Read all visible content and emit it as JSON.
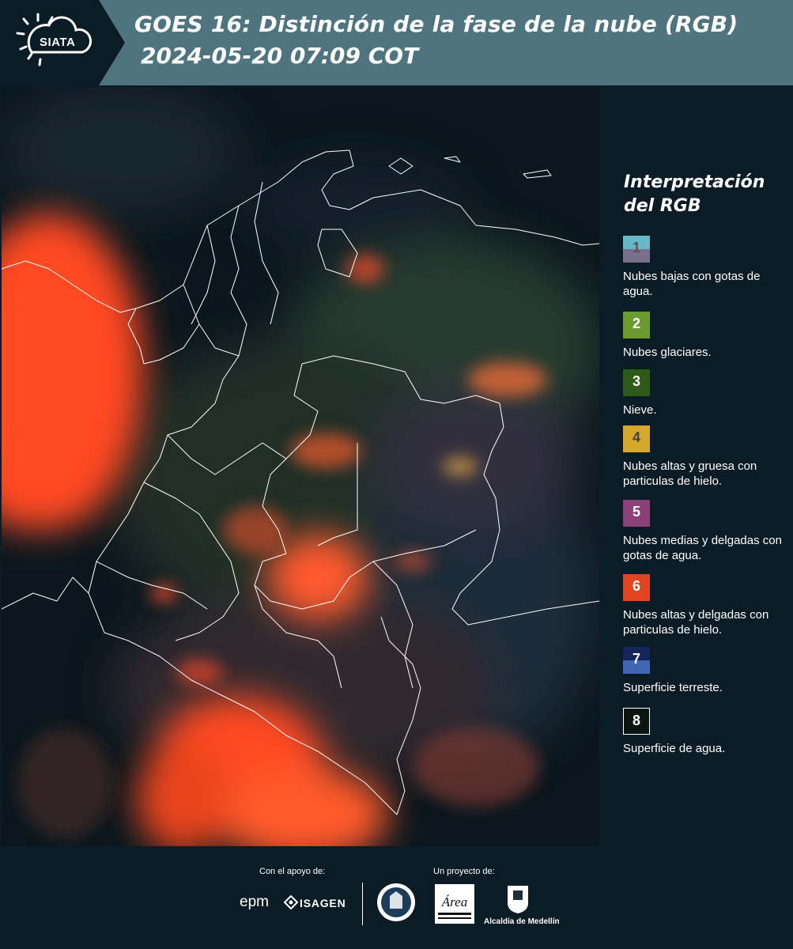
{
  "header": {
    "logo_text": "SIATA",
    "title_line1": "GOES 16: Distinción de la fase de la nube (RGB)",
    "title_line2": "2024-05-20 07:09 COT"
  },
  "legend": {
    "title_line1": "Interpretación",
    "title_line2": "del RGB",
    "items": [
      {
        "number": "1",
        "top_color": "#67b8c6",
        "bottom_color": "#7a6f8c",
        "label_color": "#555555",
        "description": "Nubes bajas con gotas de agua."
      },
      {
        "number": "2",
        "top_color": "#6b9a2e",
        "bottom_color": "#6b9a2e",
        "label_color": "#ffffff",
        "description": "Nubes glaciares."
      },
      {
        "number": "3",
        "top_color": "#2e5a19",
        "bottom_color": "#2e5a19",
        "label_color": "#ffffff",
        "description": "Nieve."
      },
      {
        "number": "4",
        "top_color": "#d5a72b",
        "bottom_color": "#d5a72b",
        "label_color": "#444444",
        "description": "Nubes altas y gruesa con particulas de hielo."
      },
      {
        "number": "5",
        "top_color": "#8c4078",
        "bottom_color": "#8c4078",
        "label_color": "#ffffff",
        "description": "Nubes medias y delgadas con gotas de agua."
      },
      {
        "number": "6",
        "top_color": "#e04520",
        "bottom_color": "#e04520",
        "label_color": "#ffffff",
        "description": "Nubes altas y delgadas con particulas de hielo."
      },
      {
        "number": "7",
        "top_color": "#16245c",
        "bottom_color": "#3f67b2",
        "label_color": "#ffffff",
        "description": "Superficie terreste."
      },
      {
        "number": "8",
        "top_color": "#0a1410",
        "bottom_color": "#0a1410",
        "label_color": "#ffffff",
        "description": "Superficie de agua."
      }
    ]
  },
  "footer": {
    "support_label": "Con el apoyo de:",
    "project_label": "Un proyecto de:",
    "sponsor_epm": "epm",
    "sponsor_isagen": "ISAGEN",
    "partner_alcaldia": "Alcaldía de Medellín"
  }
}
